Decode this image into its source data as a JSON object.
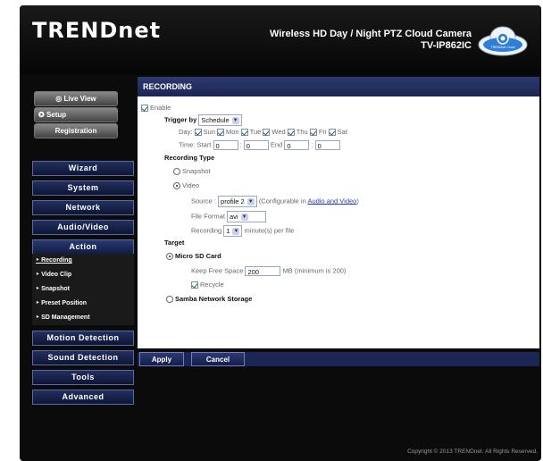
{
  "header": {
    "logo": "TRENDnet",
    "product_name": "Wireless HD Day / Night PTZ Cloud Camera",
    "model": "TV-IP862IC",
    "cloud_icon_label": "TRENDnet Cloud"
  },
  "sidebar": {
    "live_view": "Live View",
    "setup": "Setup",
    "registration": "Registration",
    "nav": [
      "Wizard",
      "System",
      "Network",
      "Audio/Video",
      "Action",
      "Motion Detection",
      "Sound Detection",
      "Tools",
      "Advanced"
    ],
    "action_sub": [
      "Recording",
      "Video Clip",
      "Snapshot",
      "Preset Position",
      "SD Management"
    ]
  },
  "recording": {
    "title": "RECORDING",
    "enable_label": "Enable",
    "enable_checked": true,
    "trigger_label": "Trigger by",
    "trigger_value": "Schedule",
    "day_label": "Day:",
    "days": [
      {
        "label": "Sun",
        "checked": true
      },
      {
        "label": "Mon",
        "checked": true
      },
      {
        "label": "Tue",
        "checked": true
      },
      {
        "label": "Wed",
        "checked": true
      },
      {
        "label": "Thu",
        "checked": true
      },
      {
        "label": "Fri",
        "checked": true
      },
      {
        "label": "Sat",
        "checked": true
      }
    ],
    "time_label": "Time: Start",
    "start_h": "0",
    "start_m": "0",
    "end_label": "End",
    "end_h": "0",
    "end_m": "0",
    "recording_type_label": "Recording Type",
    "snapshot_label": "Snapshot",
    "video_label": "Video",
    "source_label": "Source :",
    "source_value": "profile 2",
    "source_note": "(Configurable in",
    "source_link": "Audio and Video",
    "source_note_end": ")",
    "format_label": "File Format",
    "format_value": "avi",
    "per_file_label": "Recording",
    "per_file_value": "1",
    "per_file_unit": "minute(s) per file",
    "target_label": "Target",
    "micro_sd_label": "Micro SD Card",
    "keep_free_label": "Keep Free Space",
    "keep_free_value": "200",
    "keep_free_unit": "MB (minimum is 200)",
    "recycle_label": "Recycle",
    "recycle_checked": true,
    "samba_label": "Samba Network Storage"
  },
  "buttons": {
    "apply": "Apply",
    "cancel": "Cancel"
  },
  "footer": {
    "copyright": "Copyright © 2013 TRENDnet. All Rights Reserved."
  },
  "colors": {
    "nav_bg": "#1c2654",
    "accent_link": "#2a40b0"
  }
}
